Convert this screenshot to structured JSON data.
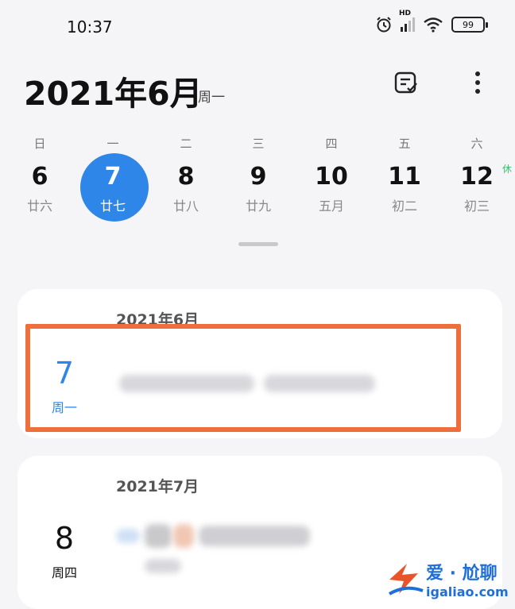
{
  "status_bar": {
    "time": "10:37",
    "network": "HD",
    "battery": "99"
  },
  "header": {
    "month_title": "2021年6月",
    "weekday": "周一"
  },
  "week": [
    {
      "weekday": "日",
      "day": "6",
      "lunar": "廿六",
      "selected": false
    },
    {
      "weekday": "一",
      "day": "7",
      "lunar": "廿七",
      "selected": true
    },
    {
      "weekday": "二",
      "day": "8",
      "lunar": "廿八",
      "selected": false
    },
    {
      "weekday": "三",
      "day": "9",
      "lunar": "廿九",
      "selected": false
    },
    {
      "weekday": "四",
      "day": "10",
      "lunar": "五月",
      "selected": false
    },
    {
      "weekday": "五",
      "day": "11",
      "lunar": "初二",
      "selected": false
    },
    {
      "weekday": "六",
      "day": "12",
      "lunar": "初三",
      "selected": false,
      "badge": "休"
    }
  ],
  "events": [
    {
      "month_label": "2021年6月",
      "date": "7",
      "weekday": "周一"
    },
    {
      "month_label": "2021年7月",
      "date": "8",
      "weekday": "周四"
    }
  ],
  "watermark": {
    "brand": "爱 · 尬聊",
    "site": "igaliao.com"
  },
  "colors": {
    "accent": "#2f86e9",
    "highlight": "#ef6f3c",
    "holiday": "#3fbf6a"
  }
}
